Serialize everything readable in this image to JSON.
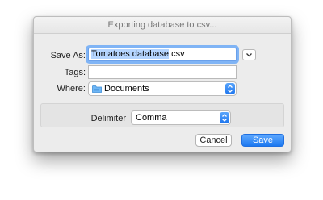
{
  "dialog": {
    "title": "Exporting database to csv...",
    "save_as": {
      "label": "Save As:",
      "selected_text": "Tomatoes database",
      "extension": ".csv"
    },
    "tags": {
      "label": "Tags:",
      "value": ""
    },
    "where": {
      "label": "Where:",
      "value": "Documents",
      "icon": "folder-icon"
    },
    "delimiter": {
      "label": "Delimiter",
      "value": "Comma"
    },
    "buttons": {
      "cancel": "Cancel",
      "save": "Save"
    },
    "colors": {
      "accent": "#1c78f0",
      "selection": "#b5d5ff",
      "focus_ring": "#80b4f5"
    }
  }
}
